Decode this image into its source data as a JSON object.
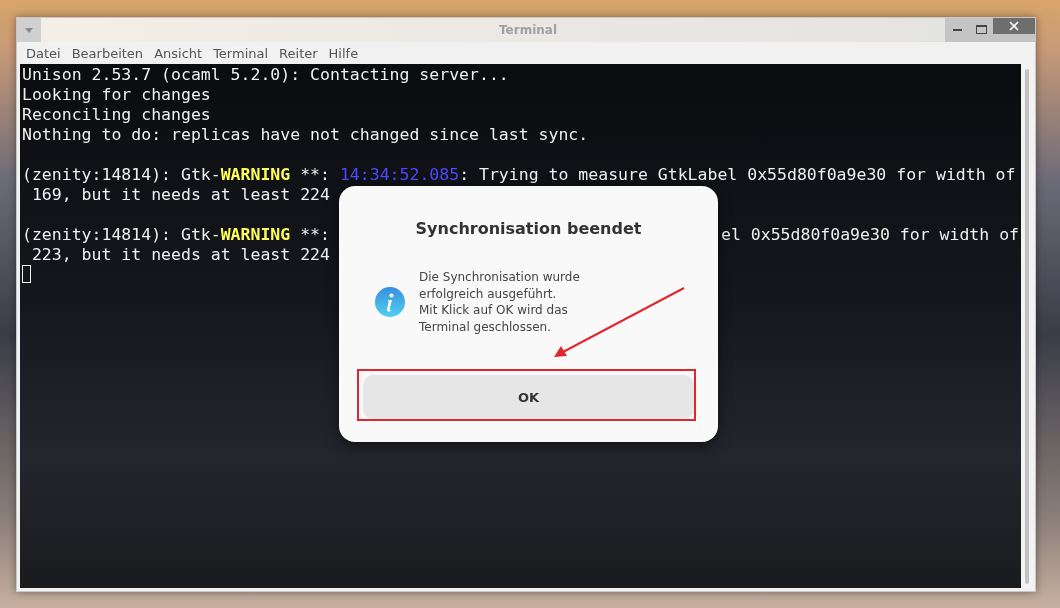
{
  "window": {
    "title": "Terminal"
  },
  "menu": [
    "Datei",
    "Bearbeiten",
    "Ansicht",
    "Terminal",
    "Reiter",
    "Hilfe"
  ],
  "terminal_lines": [
    {
      "segments": [
        {
          "kind": "text",
          "text": "Unison 2.53.7 (ocaml 5.2.0): Contacting server..."
        }
      ]
    },
    {
      "segments": [
        {
          "kind": "text",
          "text": "Looking for changes"
        }
      ]
    },
    {
      "segments": [
        {
          "kind": "text",
          "text": "Reconciling changes"
        }
      ]
    },
    {
      "segments": [
        {
          "kind": "text",
          "text": "Nothing to do: replicas have not changed since last sync."
        }
      ]
    },
    {
      "kind": "blank"
    },
    {
      "segments": [
        {
          "kind": "text",
          "text": "(zenity:14814): Gtk-"
        },
        {
          "kind": "warning",
          "text": "WARNING"
        },
        {
          "kind": "text",
          "text": " **: "
        },
        {
          "kind": "time",
          "text": "14:34:52.085"
        },
        {
          "kind": "text",
          "text": ": Trying to measure GtkLabel 0x55d80f0a9e30 for width of"
        }
      ]
    },
    {
      "segments": [
        {
          "kind": "text",
          "text": " 169, but it needs at least 224"
        }
      ]
    },
    {
      "kind": "blank"
    },
    {
      "segments": [
        {
          "kind": "text",
          "text": "(zenity:14814): Gtk-"
        },
        {
          "kind": "warning",
          "text": "WARNING"
        },
        {
          "kind": "text",
          "text": " **:"
        },
        {
          "kind": "right",
          "text": "el 0x55d80f0a9e30 for width of"
        }
      ]
    },
    {
      "segments": [
        {
          "kind": "text",
          "text": " 223, but it needs at least 224"
        }
      ]
    }
  ],
  "dialog": {
    "title": "Synchronisation beendet",
    "message": "Die Synchronisation wurde\nerfolgreich ausgeführt.\nMit Klick auf OK wird das\nTerminal geschlossen.",
    "button": "OK"
  }
}
